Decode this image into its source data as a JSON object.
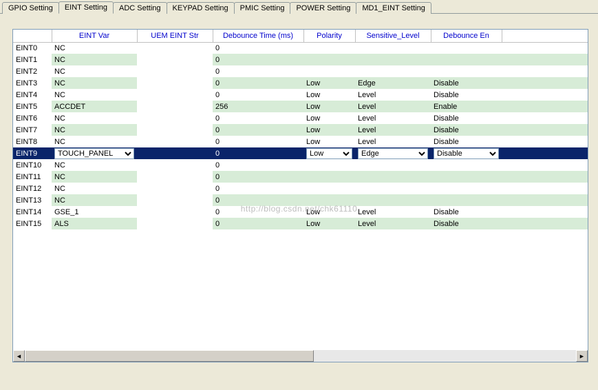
{
  "tabs": [
    {
      "label": "GPIO Setting"
    },
    {
      "label": "EINT Setting"
    },
    {
      "label": "ADC Setting"
    },
    {
      "label": "KEYPAD Setting"
    },
    {
      "label": "PMIC Setting"
    },
    {
      "label": "POWER Setting"
    },
    {
      "label": "MD1_EINT Setting"
    }
  ],
  "active_tab": 1,
  "headers": {
    "id": "",
    "var": "EINT Var",
    "uem": "UEM EINT Str",
    "deb": "Debounce Time (ms)",
    "pol": "Polarity",
    "sens": "Sensitive_Level",
    "den": "Debounce En"
  },
  "rows": [
    {
      "id": "EINT0",
      "var": "NC",
      "uem": "",
      "deb": "0",
      "pol": "",
      "sens": "",
      "den": ""
    },
    {
      "id": "EINT1",
      "var": "NC",
      "uem": "",
      "deb": "0",
      "pol": "",
      "sens": "",
      "den": ""
    },
    {
      "id": "EINT2",
      "var": "NC",
      "uem": "",
      "deb": "0",
      "pol": "",
      "sens": "",
      "den": ""
    },
    {
      "id": "EINT3",
      "var": "NC",
      "uem": "",
      "deb": "0",
      "pol": "Low",
      "sens": "Edge",
      "den": "Disable"
    },
    {
      "id": "EINT4",
      "var": "NC",
      "uem": "",
      "deb": "0",
      "pol": "Low",
      "sens": "Level",
      "den": "Disable"
    },
    {
      "id": "EINT5",
      "var": "ACCDET",
      "uem": "",
      "deb": "256",
      "pol": "Low",
      "sens": "Level",
      "den": "Enable"
    },
    {
      "id": "EINT6",
      "var": "NC",
      "uem": "",
      "deb": "0",
      "pol": "Low",
      "sens": "Level",
      "den": "Disable"
    },
    {
      "id": "EINT7",
      "var": "NC",
      "uem": "",
      "deb": "0",
      "pol": "Low",
      "sens": "Level",
      "den": "Disable"
    },
    {
      "id": "EINT8",
      "var": "NC",
      "uem": "",
      "deb": "0",
      "pol": "Low",
      "sens": "Level",
      "den": "Disable"
    },
    {
      "id": "EINT9",
      "var": "TOUCH_PANEL",
      "uem": "",
      "deb": "0",
      "pol": "Low",
      "sens": "Edge",
      "den": "Disable",
      "selected": true
    },
    {
      "id": "EINT10",
      "var": "NC",
      "uem": "",
      "deb": "0",
      "pol": "",
      "sens": "",
      "den": ""
    },
    {
      "id": "EINT11",
      "var": "NC",
      "uem": "",
      "deb": "0",
      "pol": "",
      "sens": "",
      "den": ""
    },
    {
      "id": "EINT12",
      "var": "NC",
      "uem": "",
      "deb": "0",
      "pol": "",
      "sens": "",
      "den": ""
    },
    {
      "id": "EINT13",
      "var": "NC",
      "uem": "",
      "deb": "0",
      "pol": "",
      "sens": "",
      "den": ""
    },
    {
      "id": "EINT14",
      "var": "GSE_1",
      "uem": "",
      "deb": "0",
      "pol": "Low",
      "sens": "Level",
      "den": "Disable"
    },
    {
      "id": "EINT15",
      "var": "ALS",
      "uem": "",
      "deb": "0",
      "pol": "Low",
      "sens": "Level",
      "den": "Disable"
    }
  ],
  "watermark": "http://blog.csdn.net/chk61110"
}
